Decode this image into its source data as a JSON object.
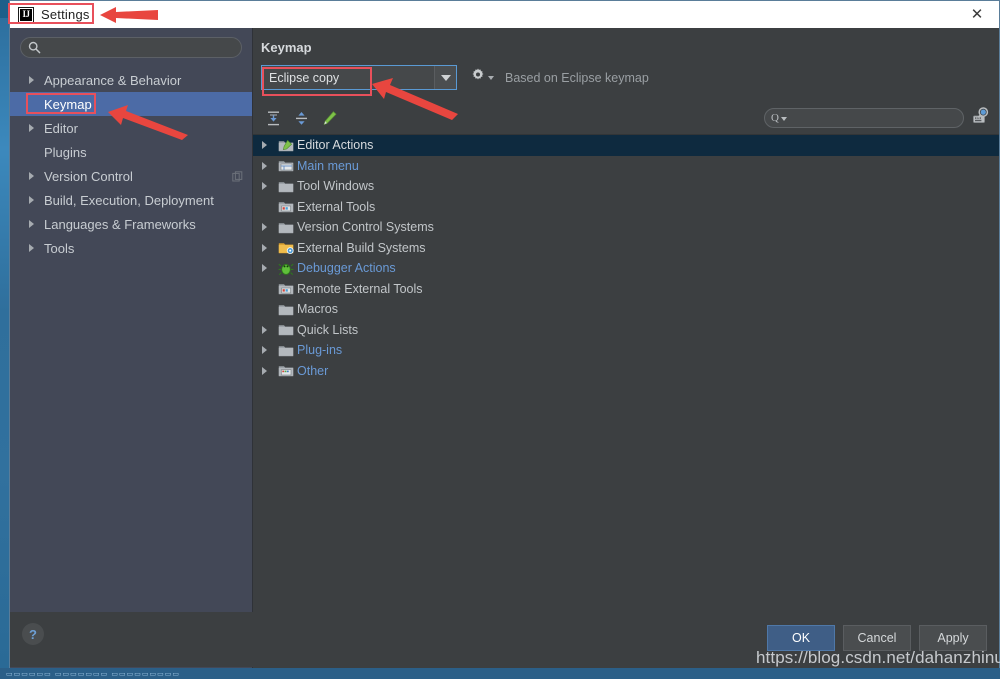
{
  "window": {
    "title": "Settings",
    "app_icon": "IJ",
    "close_icon": "close-icon"
  },
  "sidebar": {
    "search_placeholder": "",
    "search_value": "",
    "search_icon": "search-icon",
    "items": [
      {
        "label": "Appearance & Behavior",
        "expandable": true,
        "selected": false
      },
      {
        "label": "Keymap",
        "expandable": false,
        "selected": true
      },
      {
        "label": "Editor",
        "expandable": true,
        "selected": false
      },
      {
        "label": "Plugins",
        "expandable": false,
        "selected": false
      },
      {
        "label": "Version Control",
        "expandable": true,
        "selected": false,
        "badge_icon": "copy-icon"
      },
      {
        "label": "Build, Execution, Deployment",
        "expandable": true,
        "selected": false
      },
      {
        "label": "Languages & Frameworks",
        "expandable": true,
        "selected": false
      },
      {
        "label": "Tools",
        "expandable": true,
        "selected": false
      }
    ]
  },
  "main": {
    "title": "Keymap",
    "keymap_select": {
      "value": "Eclipse copy",
      "caret_icon": "chevron-down-icon"
    },
    "gear_icon": "gear-icon",
    "based_on": "Based on Eclipse keymap",
    "toolbar": {
      "expand_all_icon": "expand-all-icon",
      "collapse_all_icon": "collapse-all-icon",
      "edit_shortcut_icon": "pencil-icon",
      "search_placeholder": "",
      "search_value": "",
      "search_icon": "search-icon",
      "find_by_shortcut_icon": "find-by-shortcut-icon"
    },
    "action_tree": [
      {
        "label": "Editor Actions",
        "expandable": true,
        "selected": true,
        "blue": false,
        "icon": "folder-editor-icon"
      },
      {
        "label": "Main menu",
        "expandable": true,
        "selected": false,
        "blue": true,
        "icon": "folder-menu-icon"
      },
      {
        "label": "Tool Windows",
        "expandable": true,
        "selected": false,
        "blue": false,
        "icon": "folder-icon"
      },
      {
        "label": "External Tools",
        "expandable": false,
        "selected": false,
        "blue": false,
        "icon": "folder-tools-icon"
      },
      {
        "label": "Version Control Systems",
        "expandable": true,
        "selected": false,
        "blue": false,
        "icon": "folder-icon"
      },
      {
        "label": "External Build Systems",
        "expandable": true,
        "selected": false,
        "blue": false,
        "icon": "folder-build-icon"
      },
      {
        "label": "Debugger Actions",
        "expandable": true,
        "selected": false,
        "blue": true,
        "icon": "bug-icon"
      },
      {
        "label": "Remote External Tools",
        "expandable": false,
        "selected": false,
        "blue": false,
        "icon": "folder-tools-icon"
      },
      {
        "label": "Macros",
        "expandable": false,
        "selected": false,
        "blue": false,
        "icon": "folder-icon"
      },
      {
        "label": "Quick Lists",
        "expandable": true,
        "selected": false,
        "blue": false,
        "icon": "folder-icon"
      },
      {
        "label": "Plug-ins",
        "expandable": true,
        "selected": false,
        "blue": true,
        "icon": "folder-icon"
      },
      {
        "label": "Other",
        "expandable": true,
        "selected": false,
        "blue": true,
        "icon": "folder-other-icon"
      }
    ]
  },
  "footer": {
    "help_label": "?",
    "ok_label": "OK",
    "cancel_label": "Cancel",
    "apply_label": "Apply"
  },
  "watermark": "https://blog.csdn.net/dahanzhinu",
  "colors": {
    "accent_blue": "#4c6ba6",
    "annotation_red": "#e8505b",
    "panel_bg": "#3c3f41",
    "sidebar_bg": "#434857",
    "tree_selection": "#0e2a3f",
    "link_blue": "#6a9ad6"
  }
}
